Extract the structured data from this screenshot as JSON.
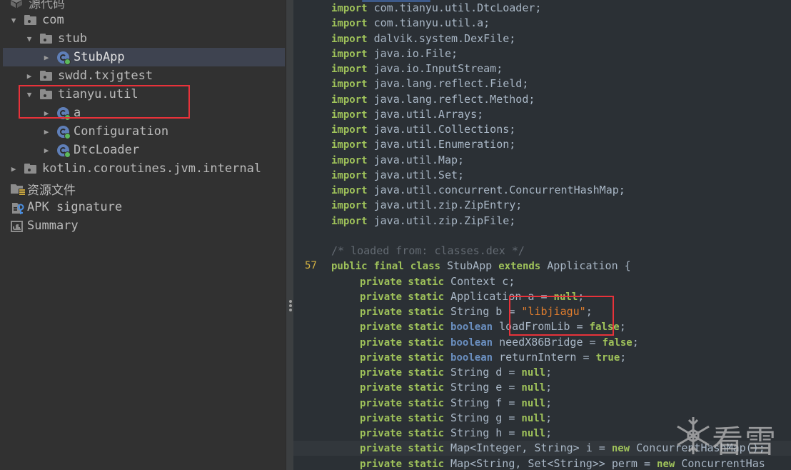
{
  "tree": {
    "root": {
      "label": "源代码",
      "icon": "source-root-icon"
    },
    "items": [
      {
        "label": "com",
        "type": "package",
        "expanded": true,
        "level": 1
      },
      {
        "label": "stub",
        "type": "package",
        "expanded": true,
        "level": 2
      },
      {
        "label": "StubApp",
        "type": "class",
        "expanded": false,
        "level": 3,
        "selected": true
      },
      {
        "label": "swdd.txjgtest",
        "type": "package",
        "expanded": false,
        "level": 2
      },
      {
        "label": "tianyu.util",
        "type": "package",
        "expanded": true,
        "level": 2,
        "highlighted": true
      },
      {
        "label": "a",
        "type": "class",
        "expanded": false,
        "level": 3
      },
      {
        "label": "Configuration",
        "type": "class",
        "expanded": false,
        "level": 3
      },
      {
        "label": "DtcLoader",
        "type": "class",
        "expanded": false,
        "level": 3
      },
      {
        "label": "kotlin.coroutines.jvm.internal",
        "type": "package",
        "expanded": false,
        "level": 1
      }
    ],
    "resources": {
      "label": "资源文件",
      "icon": "resources-folder-icon"
    },
    "signature": {
      "label": "APK signature",
      "icon": "apk-signature-icon"
    },
    "summary": {
      "label": "Summary",
      "icon": "summary-icon"
    }
  },
  "editor": {
    "imports": [
      "com.tianyu.util.DtcLoader;",
      "com.tianyu.util.a;",
      "dalvik.system.DexFile;",
      "java.io.File;",
      "java.io.InputStream;",
      "java.lang.reflect.Field;",
      "java.lang.reflect.Method;",
      "java.util.Arrays;",
      "java.util.Collections;",
      "java.util.Enumeration;",
      "java.util.Map;",
      "java.util.Set;",
      "java.util.concurrent.ConcurrentHashMap;",
      "java.util.zip.ZipEntry;",
      "java.util.zip.ZipFile;"
    ],
    "import_keyword": "import",
    "comment": "/* loaded from: classes.dex */",
    "class_decl": {
      "line_number": "57",
      "kw1": "public",
      "kw2": "final",
      "kw3": "class",
      "name": "StubApp",
      "kw4": "extends",
      "parent": "Application {"
    },
    "fields": [
      {
        "mods": "private static",
        "type": "Context",
        "type_kw": false,
        "rest": " c;",
        "value": null,
        "value_kind": null
      },
      {
        "mods": "private static",
        "type": "Application",
        "type_kw": false,
        "rest": " a = ",
        "value": "null",
        "value_kind": "kw",
        "end": ";"
      },
      {
        "mods": "private static",
        "type": "String",
        "type_kw": false,
        "rest": " b = ",
        "value": "\"libjiagu\"",
        "value_kind": "str",
        "end": ";"
      },
      {
        "mods": "private static",
        "type": "boolean",
        "type_kw": true,
        "rest": " loadFromLib = ",
        "value": "false",
        "value_kind": "kw",
        "end": ";"
      },
      {
        "mods": "private static",
        "type": "boolean",
        "type_kw": true,
        "rest": " needX86Bridge = ",
        "value": "false",
        "value_kind": "kw",
        "end": ";"
      },
      {
        "mods": "private static",
        "type": "boolean",
        "type_kw": true,
        "rest": " returnIntern = ",
        "value": "true",
        "value_kind": "kw",
        "end": ";"
      },
      {
        "mods": "private static",
        "type": "String",
        "type_kw": false,
        "rest": " d = ",
        "value": "null",
        "value_kind": "kw",
        "end": ";"
      },
      {
        "mods": "private static",
        "type": "String",
        "type_kw": false,
        "rest": " e = ",
        "value": "null",
        "value_kind": "kw",
        "end": ";"
      },
      {
        "mods": "private static",
        "type": "String",
        "type_kw": false,
        "rest": " f = ",
        "value": "null",
        "value_kind": "kw",
        "end": ";"
      },
      {
        "mods": "private static",
        "type": "String",
        "type_kw": false,
        "rest": " g = ",
        "value": "null",
        "value_kind": "kw",
        "end": ";"
      },
      {
        "mods": "private static",
        "type": "String",
        "type_kw": false,
        "rest": " h = ",
        "value": "null",
        "value_kind": "kw",
        "end": ";"
      },
      {
        "mods": "private static",
        "type": "Map<Integer, String>",
        "type_kw": false,
        "rest": " i = ",
        "value": "new",
        "value_kind": "kw",
        "end": " ConcurrentHashMap();",
        "current": true
      },
      {
        "mods": "private static",
        "type": "Map<String, Set<String>>",
        "type_kw": false,
        "rest": " perm = ",
        "value": "new",
        "value_kind": "kw",
        "end": " ConcurrentHas"
      }
    ]
  },
  "watermark": {
    "text": "看雪",
    "icon": "snowflake-icon"
  },
  "colors": {
    "keyword": "#9fc25a",
    "type_keyword": "#6a8fc0",
    "string": "#e07d2d",
    "identifier": "#a9b7c6",
    "comment": "#636a72",
    "line_number": "#d5b343",
    "highlight_box": "#e8323a",
    "selection": "#3e4350"
  }
}
